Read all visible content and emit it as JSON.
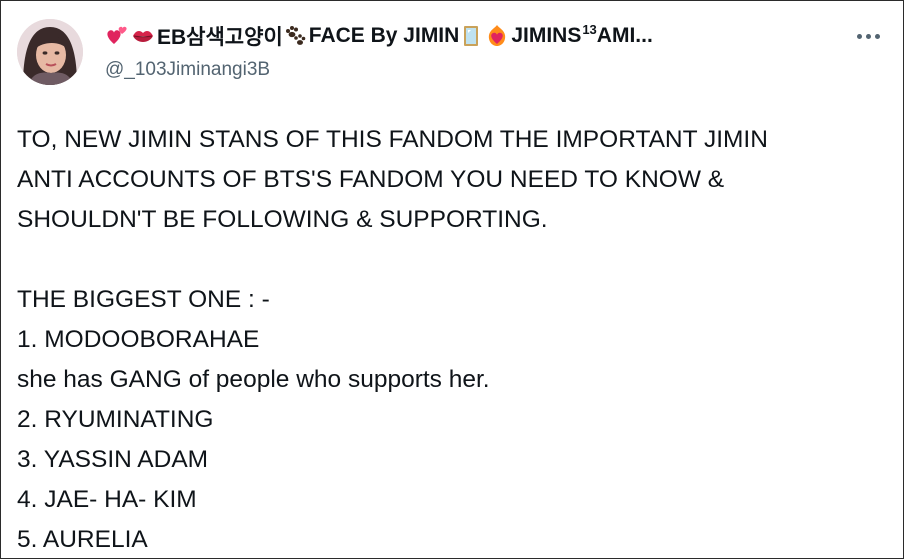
{
  "tweet": {
    "author": {
      "name_parts": [
        "EB삼색고양이",
        "FACE By JIMIN",
        "JIMINS",
        "13",
        " AMI..."
      ],
      "handle": "@_103Jiminangi3B",
      "emoji_icons": [
        "two-hearts-icon",
        "kiss-mark-icon",
        "paw-prints-icon",
        "mirror-icon",
        "heart-on-fire-icon"
      ]
    },
    "more_icon": "ellipsis-icon",
    "lines": [
      "TO, NEW JIMIN STANS OF THIS FANDOM THE IMPORTANT JIMIN",
      "ANTI ACCOUNTS OF BTS'S FANDOM YOU NEED TO KNOW &",
      "SHOULDN'T BE FOLLOWING & SUPPORTING.",
      "",
      "THE BIGGEST ONE : -",
      "1. MODOOBORAHAE",
      "she has GANG of people who supports her.",
      "2. RYUMINATING",
      "3. YASSIN ADAM",
      "4. JAE- HA- KIM",
      "5. AURELIA"
    ]
  },
  "colors": {
    "text_primary": "#0f1419",
    "text_secondary": "#536471",
    "border": "#2b2b2b",
    "heart_pink": "#e0245e",
    "lips_red": "#d6244a"
  }
}
